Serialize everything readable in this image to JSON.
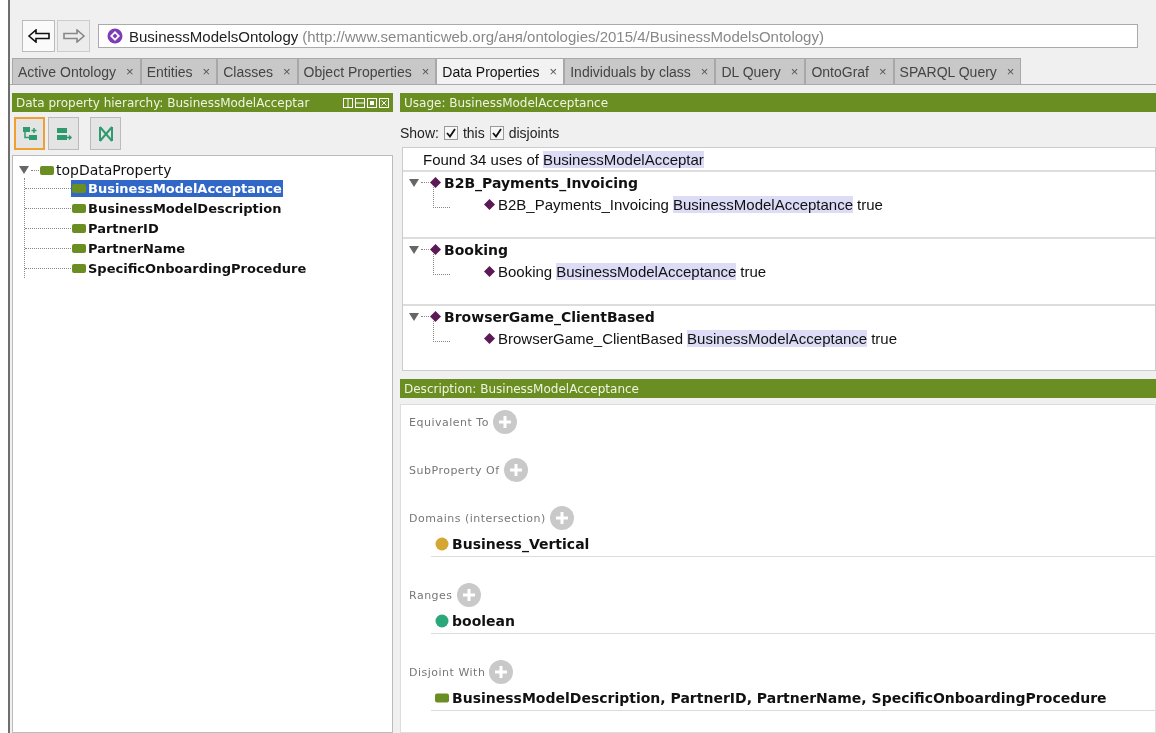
{
  "nav": {
    "back_enabled": true,
    "forward_enabled": false
  },
  "ontology": {
    "name": "BusinessModelsOntology",
    "iri": "(http://www.semanticweb.org/аня/ontologies/2015/4/BusinessModelsOntology)"
  },
  "tabs": [
    {
      "label": "Active Ontology",
      "close": "×",
      "selected": false
    },
    {
      "label": "Entities",
      "close": "×",
      "selected": false
    },
    {
      "label": "Classes",
      "close": "×",
      "selected": false
    },
    {
      "label": "Object Properties",
      "close": "×",
      "selected": false
    },
    {
      "label": "Data Properties",
      "close": "×",
      "selected": true
    },
    {
      "label": "Individuals by class",
      "close": "×",
      "selected": false
    },
    {
      "label": "DL Query",
      "close": "×",
      "selected": false
    },
    {
      "label": "OntoGraf",
      "close": "×",
      "selected": false
    },
    {
      "label": "SPARQL Query",
      "close": "×",
      "selected": false
    }
  ],
  "hierarchy_panel": {
    "title": "Data property hierarchy: BusinessModelAcceptar",
    "tool_buttons": [
      {
        "kind": "add-sub",
        "selected": true
      },
      {
        "kind": "add-sibling",
        "selected": false
      },
      {
        "kind": "delete",
        "selected": false
      }
    ],
    "tree": {
      "label": "topDataProperty",
      "expanded": true,
      "children": [
        {
          "label": "BusinessModelAcceptance",
          "selected": true
        },
        {
          "label": "BusinessModelDescription",
          "selected": false
        },
        {
          "label": "PartnerID",
          "selected": false
        },
        {
          "label": "PartnerName",
          "selected": false
        },
        {
          "label": "SpecificOnboardingProcedure",
          "selected": false
        }
      ]
    }
  },
  "usage_panel": {
    "title": "Usage: BusinessModelAcceptance",
    "show_label": "Show:",
    "options": [
      {
        "label": "this",
        "checked": true
      },
      {
        "label": "disjoints",
        "checked": true
      }
    ],
    "found_prefix": "Found 34 uses of",
    "found_entity": "BusinessModelAcceptar",
    "groups": [
      {
        "individual": "B2B_Payments_Invoicing",
        "expanded": true,
        "subject": "B2B_Payments_Invoicing",
        "property": "BusinessModelAcceptance",
        "value": "true"
      },
      {
        "individual": "Booking",
        "expanded": true,
        "subject": "Booking",
        "property": "BusinessModelAcceptance",
        "value": "true"
      },
      {
        "individual": "BrowserGame_ClientBased",
        "expanded": true,
        "subject": "BrowserGame_ClientBased",
        "property": "BusinessModelAcceptance",
        "value": "true"
      }
    ]
  },
  "description_panel": {
    "title": "Description: BusinessModelAcceptance",
    "sections": [
      {
        "label": "Equivalent To"
      },
      {
        "label": "SubProperty Of"
      },
      {
        "label": "Domains (intersection)",
        "items": [
          {
            "kind": "class",
            "text": "Business_Vertical"
          }
        ]
      },
      {
        "label": "Ranges",
        "items": [
          {
            "kind": "datatype",
            "text": "boolean"
          }
        ]
      },
      {
        "label": "Disjoint With",
        "items": [
          {
            "kind": "data_property",
            "text": "BusinessModelDescription, PartnerID, PartnerName, SpecificOnboardingProcedure"
          }
        ]
      }
    ]
  }
}
